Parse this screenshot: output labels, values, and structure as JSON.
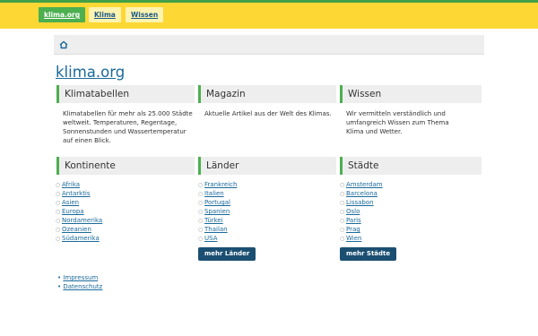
{
  "topnav": {
    "brand": "klima.org",
    "items": [
      "Klima",
      "Wissen"
    ]
  },
  "breadcrumb": {
    "home_icon": "home-icon"
  },
  "site_title": "klima.org",
  "intro_boxes": [
    {
      "title": "Klimatabellen",
      "text": "Klimatabellen für mehr als 25.000 Städte weltweit. Temperaturen, Regentage, Sonnenstunden und Wassertemperatur auf einen Blick."
    },
    {
      "title": "Magazin",
      "text": "Aktuelle Artikel aus der Welt des Klimas."
    },
    {
      "title": "Wissen",
      "text": "Wir vermitteln verständlich und umfangreich Wissen zum Thema Klima und Wetter."
    }
  ],
  "kontinente": {
    "title": "Kontinente",
    "links": [
      "Afrika",
      "Antarktis",
      "Asien",
      "Europa",
      "Nordamerika",
      "Ozeanien",
      "Südamerika"
    ]
  },
  "laender": {
    "title": "Länder",
    "links": [
      "Frankreich",
      "Italien",
      "Portugal",
      "Spanien",
      "Türkei",
      "Thailan",
      "USA"
    ],
    "more_button": "mehr Länder"
  },
  "staedte": {
    "title": "Städte",
    "links": [
      "Amsterdam",
      "Barcelona",
      "Lissabon",
      "Oslo",
      "Paris",
      "Prag",
      "Wien"
    ],
    "more_button": "mehr Städte"
  },
  "footer": {
    "links": [
      "Impressum",
      "Datenschutz"
    ]
  },
  "colors": {
    "topbar": "#fdd835",
    "accent_green": "#4caf50",
    "link_blue": "#1a6a9a",
    "button_dark": "#1b4f72"
  }
}
